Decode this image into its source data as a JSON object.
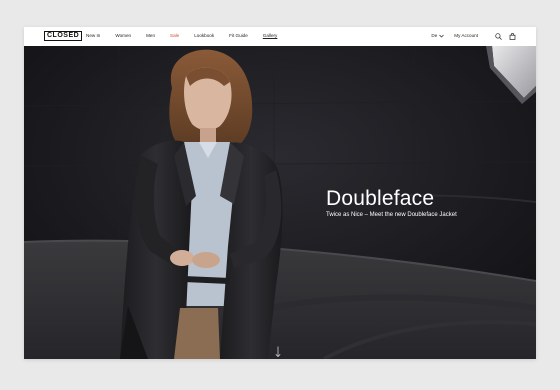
{
  "brand": {
    "logo_text": "CLOSED"
  },
  "nav": {
    "items": [
      {
        "label": "New In",
        "variant": "normal"
      },
      {
        "label": "Women",
        "variant": "normal"
      },
      {
        "label": "Men",
        "variant": "normal"
      },
      {
        "label": "Sale",
        "variant": "sale"
      },
      {
        "label": "Lookbook",
        "variant": "normal"
      },
      {
        "label": "Fit Guide",
        "variant": "normal"
      },
      {
        "label": "Gallery",
        "variant": "underline"
      }
    ],
    "language": "De",
    "account": "My Account",
    "icons": [
      "chevron-down-icon",
      "search-icon",
      "bag-icon"
    ]
  },
  "hero": {
    "title": "Doubleface",
    "subtitle": "Twice as Nice – Meet the new Doubleface Jacket",
    "scroll_icon": "arrow-down-icon"
  },
  "colors": {
    "sale": "#d14a31",
    "text": "#222222",
    "hero_text": "#ffffff",
    "page_bg": "#e9e9ea"
  }
}
